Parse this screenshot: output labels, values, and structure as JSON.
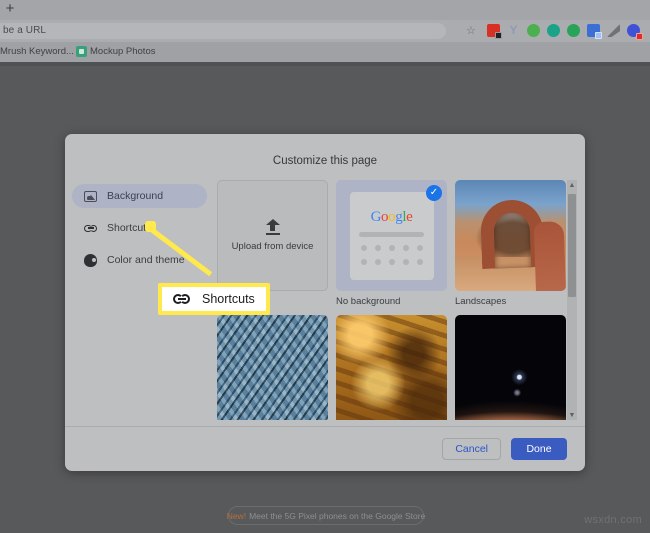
{
  "browser": {
    "new_tab_label": "+",
    "omnibox": {
      "text": "be a URL"
    },
    "bookmark_star": "☆",
    "extensions": [
      {
        "name": "extension-red",
        "color": "#d93025"
      },
      {
        "name": "extension-yellow-v",
        "color": "#8f9bb3"
      },
      {
        "name": "extension-evernote",
        "color": "#4caf50"
      },
      {
        "name": "extension-teal-badge",
        "color": "#1aa387"
      },
      {
        "name": "extension-green-circle",
        "color": "#2aa35a"
      },
      {
        "name": "extension-blue-note",
        "color": "#3b6fd4"
      },
      {
        "name": "extension-gray-pen",
        "color": "#6f7377"
      },
      {
        "name": "extension-blue-circle",
        "color": "#3f51d6"
      }
    ],
    "bookmarks": [
      {
        "label": "Mrush Keyword..."
      },
      {
        "label": "Mockup Photos"
      }
    ]
  },
  "dialog": {
    "title": "Customize this page",
    "sidebar": [
      {
        "label": "Background",
        "icon": "image-icon",
        "selected": true
      },
      {
        "label": "Shortcuts",
        "icon": "link-icon",
        "selected": false
      },
      {
        "label": "Color and theme",
        "icon": "palette-icon",
        "selected": false
      }
    ],
    "tiles": [
      {
        "label": "Upload from device",
        "type": "upload",
        "selected": false
      },
      {
        "label": "No background",
        "type": "nobackground",
        "selected": true
      },
      {
        "label": "Landscapes",
        "type": "photo-landscape",
        "selected": false
      },
      {
        "label": "",
        "type": "photo-glass",
        "selected": false
      },
      {
        "label": "",
        "type": "photo-autumn",
        "selected": false
      },
      {
        "label": "",
        "type": "photo-space",
        "selected": false
      }
    ],
    "google_logo": [
      "G",
      "o",
      "o",
      "g",
      "l",
      "e"
    ],
    "check_glyph": "✓",
    "scroll": {
      "up": "▲",
      "down": "▼"
    },
    "buttons": {
      "cancel": "Cancel",
      "done": "Done"
    }
  },
  "callout": {
    "label": "Shortcuts",
    "highlight_color": "#ffe94d"
  },
  "promo": {
    "new_label": "New!",
    "text": "Meet the 5G Pixel phones on the Google Store"
  },
  "watermark": "wsxdn.com"
}
